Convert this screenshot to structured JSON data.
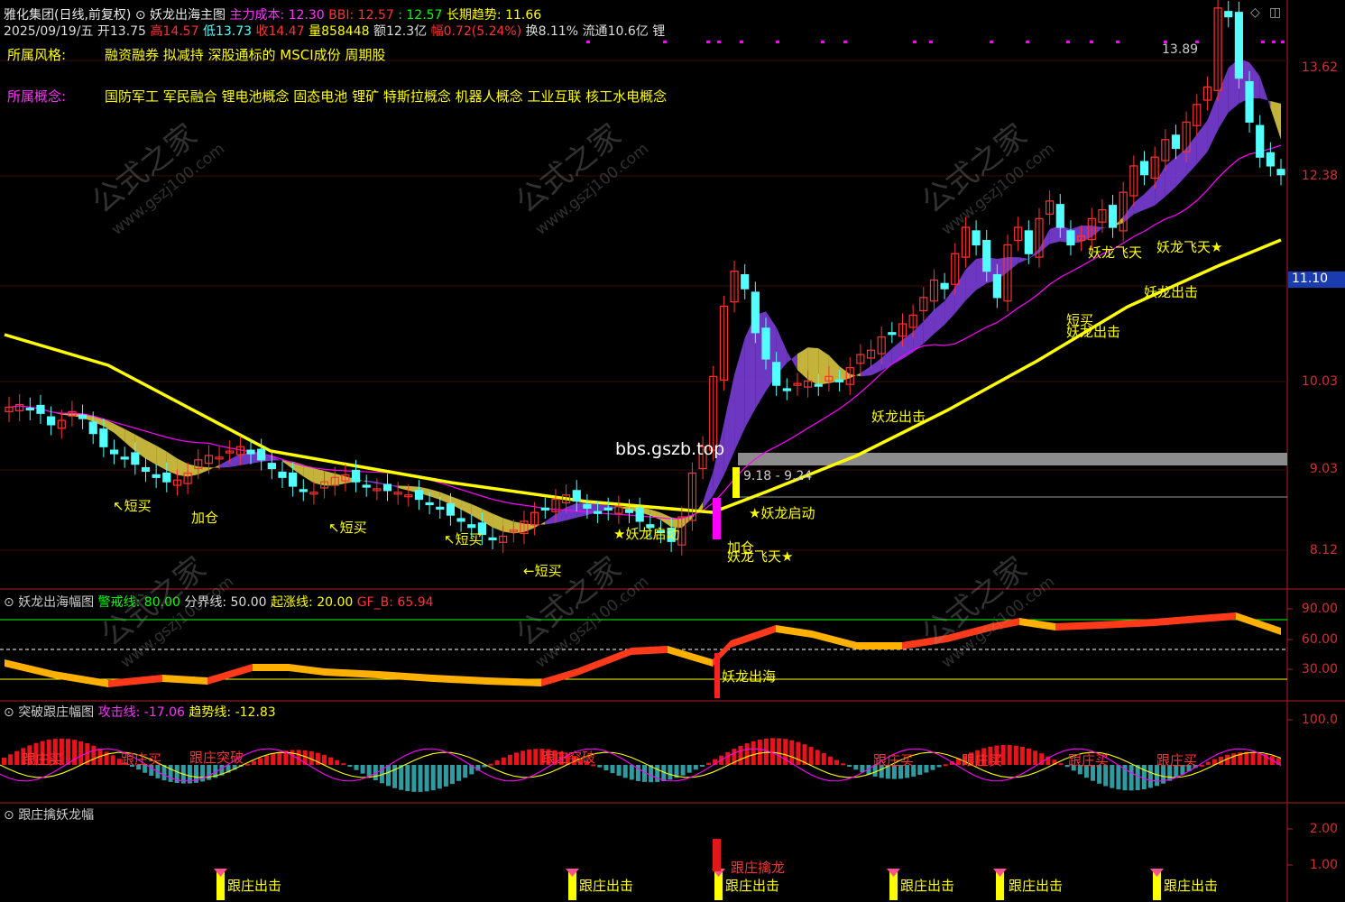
{
  "header": {
    "stock_name": "雅化集团(日线,前复权)",
    "indicator_name": "妖龙出海主图",
    "main_cost_label": "主力成本",
    "main_cost_value": ": 12.30",
    "bbi_label": "BBI",
    "bbi_value": ": 12.57",
    "dot_value": ": 12.57",
    "long_trend_label": "长期趋势",
    "long_trend_value": ": 11.66",
    "date": "2025/09/19/五",
    "open_label": "开",
    "open_value": "13.75",
    "high_label": "高",
    "high_value": "14.57",
    "low_label": "低",
    "low_value": "13.73",
    "close_label": "收",
    "close_value": "14.47",
    "volume_label": "量",
    "volume_value": "858448",
    "amount_label": "额",
    "amount_value": "12.3亿",
    "change_label": "幅",
    "change_value": "0.72(5.24%)",
    "turnover_label": "换",
    "turnover_value": "8.11%",
    "float_label": "流通",
    "float_value": "10.6亿",
    "extra": "锂"
  },
  "info": {
    "style_label": "所属风格:",
    "style_value": "融资融券 拟减持 深股通标的 MSCI成份 周期股",
    "concept_label": "所属概念:",
    "concept_value": "国防军工 军民融合 锂电池概念 固态电池 锂矿 特斯拉概念 机器人概念 工业互联 核工水电概念"
  },
  "watermark": {
    "cn": "公式之家",
    "url": "www.gszj100.com",
    "site": "bbs.gszb.top"
  },
  "price_axis": [
    "13.62",
    "12.38",
    "11.10",
    "10.03",
    "9.03",
    "8.12"
  ],
  "price_marker": "11.10",
  "peak_label": "13.89",
  "range_label": "9.18 - 9.24",
  "main_annotations": [
    {
      "id": "a1",
      "text": "↖短买"
    },
    {
      "id": "a2",
      "text": "加仓"
    },
    {
      "id": "a3",
      "text": "↖短买"
    },
    {
      "id": "a4",
      "text": "↖短买"
    },
    {
      "id": "a5",
      "text": "←短买"
    },
    {
      "id": "a6",
      "text": "★妖龙启动"
    },
    {
      "id": "a7",
      "text": "加仓"
    },
    {
      "id": "a8",
      "text": "妖龙飞天★"
    },
    {
      "id": "a9",
      "text": "★妖龙启动"
    },
    {
      "id": "a10",
      "text": "妖龙出击"
    },
    {
      "id": "a11",
      "text": "短买"
    },
    {
      "id": "a12",
      "text": "妖龙出击"
    },
    {
      "id": "a13",
      "text": "妖龙飞天"
    },
    {
      "id": "a14",
      "text": "妖龙飞天★"
    },
    {
      "id": "a15",
      "text": "妖龙出击"
    }
  ],
  "panel1": {
    "title": "妖龙出海幅图",
    "warn_label": "警戒线: 80.00",
    "divide_label": "分界线: 50.00",
    "rise_label": "起涨线: 20.00",
    "gf_label": "GF_B: 65.94",
    "axis": [
      "90.00",
      "60.00",
      "30.00"
    ],
    "annotation": "妖龙出海"
  },
  "panel2": {
    "title": "突破跟庄幅图",
    "attack_label": "攻击线: -17.06",
    "trend_label": "趋势线: -12.83",
    "axis": [
      "100.0"
    ],
    "annotations": [
      "跟庄买",
      "跟庄买",
      "跟庄突破",
      "跟庄突破",
      "跟庄买",
      "跟庄买",
      "跟庄买",
      "跟庄买"
    ]
  },
  "panel3": {
    "title": "跟庄擒妖龙幅",
    "axis": [
      "2.00",
      "1.00"
    ],
    "catch_label": "跟庄擒龙",
    "annotations": [
      "跟庄出击",
      "跟庄出击",
      "跟庄出击",
      "跟庄出击",
      "跟庄出击",
      "跟庄出击"
    ]
  },
  "colors": {
    "up": "#ff3232",
    "down": "#54ffff",
    "yellow": "#ffff00",
    "magenta": "#ff00ff",
    "purple": "#7a3dd6",
    "axis_red": "#d03030",
    "green": "#00ff00"
  },
  "chart_data": {
    "type": "candlestick",
    "closes": [
      9.75,
      9.78,
      9.72,
      9.68,
      9.55,
      9.6,
      9.7,
      9.62,
      9.45,
      9.3,
      9.22,
      9.18,
      9.1,
      9.02,
      8.95,
      8.9,
      8.92,
      9.0,
      9.15,
      9.2,
      9.18,
      9.25,
      9.3,
      9.22,
      9.15,
      9.05,
      8.95,
      8.85,
      8.8,
      8.78,
      8.9,
      8.95,
      8.98,
      8.9,
      8.85,
      8.82,
      8.8,
      8.78,
      8.75,
      8.7,
      8.65,
      8.6,
      8.52,
      8.45,
      8.38,
      8.3,
      8.25,
      8.28,
      8.35,
      8.45,
      8.55,
      8.6,
      8.7,
      8.75,
      8.68,
      8.6,
      8.55,
      8.58,
      8.62,
      8.55,
      8.45,
      8.38,
      8.32,
      8.22,
      8.5,
      9.0,
      9.3,
      10.1,
      10.9,
      11.3,
      11.1,
      10.6,
      10.3,
      10.0,
      9.95,
      10.02,
      10.05,
      10.0,
      10.1,
      10.05,
      10.2,
      10.35,
      10.4,
      10.55,
      10.6,
      10.7,
      10.8,
      11.0,
      11.2,
      11.1,
      11.5,
      11.8,
      11.6,
      11.3,
      11.0,
      11.6,
      11.8,
      11.5,
      11.9,
      12.1,
      11.8,
      11.6,
      11.7,
      11.9,
      12.0,
      11.8,
      12.2,
      12.5,
      12.4,
      12.6,
      12.8,
      12.7,
      13.0,
      13.2,
      13.4,
      14.3,
      14.2,
      13.5,
      13.0,
      12.6,
      12.5,
      12.4
    ]
  }
}
